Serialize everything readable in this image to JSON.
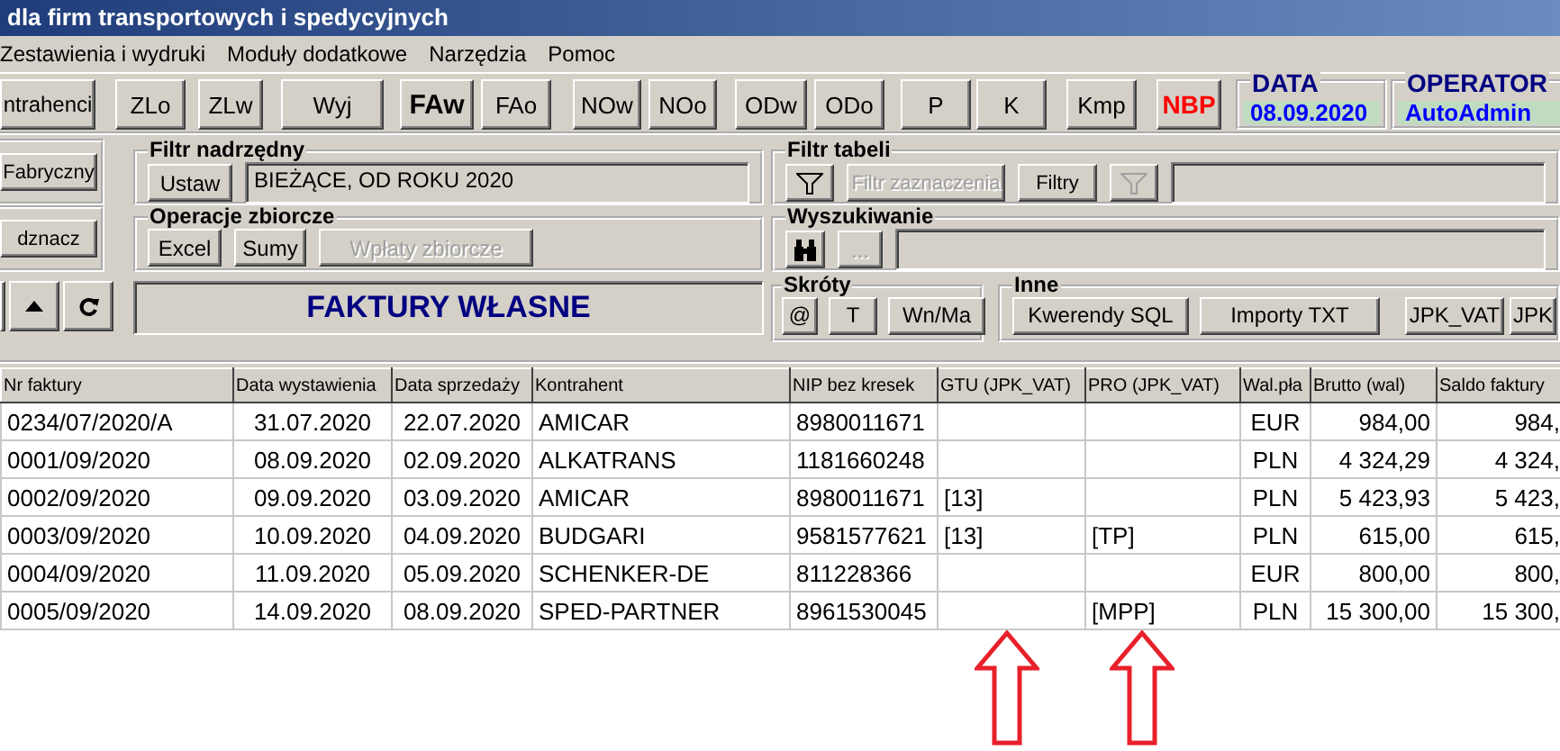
{
  "window": {
    "title": "dla firm transportowych i spedycyjnych"
  },
  "menu": [
    "Zestawienia i wydruki",
    "Moduły dodatkowe",
    "Narzędzia",
    "Pomoc"
  ],
  "toolbar": [
    {
      "label": "ntrahenci",
      "kind": "normal"
    },
    {
      "label": "ZLo",
      "kind": "normal"
    },
    {
      "label": "ZLw",
      "kind": "normal"
    },
    {
      "label": "Wyj",
      "kind": "normal"
    },
    {
      "label": "FAw",
      "kind": "bold"
    },
    {
      "label": "FAo",
      "kind": "normal"
    },
    {
      "label": "NOw",
      "kind": "normal"
    },
    {
      "label": "NOo",
      "kind": "normal"
    },
    {
      "label": "ODw",
      "kind": "normal"
    },
    {
      "label": "ODo",
      "kind": "normal"
    },
    {
      "label": "P",
      "kind": "normal"
    },
    {
      "label": "K",
      "kind": "normal"
    },
    {
      "label": "Kmp",
      "kind": "normal"
    },
    {
      "label": "NBP",
      "kind": "alert"
    }
  ],
  "info": [
    {
      "label": "DATA",
      "value": "08.09.2020"
    },
    {
      "label": "OPERATOR",
      "value": "AutoAdmin"
    }
  ],
  "side_buttons": [
    "Fabryczny",
    "dznacz"
  ],
  "filtr_nadrzedny": {
    "title": "Filtr nadrzędny",
    "button": "Ustaw",
    "value": "BIEŻĄCE, OD ROKU 2020"
  },
  "operacje_zbiorcze": {
    "title": "Operacje zbiorcze",
    "buttons": [
      {
        "label": "Excel",
        "disabled": false
      },
      {
        "label": "Sumy",
        "disabled": false
      },
      {
        "label": "Wpłaty zbiorcze",
        "disabled": true
      }
    ]
  },
  "banner": "FAKTURY WŁASNE",
  "filtr_tabeli": {
    "title": "Filtr tabeli",
    "tools": [
      {
        "kind": "funnel",
        "disabled": false
      },
      {
        "kind": "text",
        "label": "Filtr zaznaczenia",
        "disabled": true
      },
      {
        "kind": "text",
        "label": "Filtry",
        "disabled": false
      },
      {
        "kind": "funnel",
        "disabled": true
      }
    ]
  },
  "wyszukiwanie": {
    "title": "Wyszukiwanie",
    "tools": [
      {
        "kind": "binoculars",
        "disabled": false
      },
      {
        "kind": "text",
        "label": "...",
        "disabled": true
      }
    ]
  },
  "skroty": {
    "title": "Skróty",
    "buttons": [
      "@",
      "T",
      "Wn/Ma"
    ]
  },
  "inne": {
    "title": "Inne",
    "buttons": [
      "Kwerendy SQL",
      "Importy TXT",
      "JPK_VAT",
      "JPK"
    ]
  },
  "table": {
    "columns": [
      "Nr faktury",
      "Data wystawienia",
      "Data sprzedaży",
      "Kontrahent",
      "NIP bez kresek",
      "GTU (JPK_VAT)",
      "PRO (JPK_VAT)",
      "Wal.pła",
      "Brutto (wal)",
      "Saldo faktury"
    ],
    "rows": [
      [
        "0234/07/2020/A",
        "31.07.2020",
        "22.07.2020",
        "AMICAR",
        "8980011671",
        null,
        null,
        "EUR",
        "984,00",
        "984,"
      ],
      [
        "0001/09/2020",
        "08.09.2020",
        "02.09.2020",
        "ALKATRANS",
        "1181660248",
        null,
        null,
        "PLN",
        "4 324,29",
        "4 324,"
      ],
      [
        "0002/09/2020",
        "09.09.2020",
        "03.09.2020",
        "AMICAR",
        "8980011671",
        "[13]",
        null,
        "PLN",
        "5 423,93",
        "5 423,"
      ],
      [
        "0003/09/2020",
        "10.09.2020",
        "04.09.2020",
        "BUDGARI",
        "9581577621",
        "[13]",
        "[TP]",
        "PLN",
        "615,00",
        "615,"
      ],
      [
        "0004/09/2020",
        "11.09.2020",
        "05.09.2020",
        "SCHENKER-DE",
        "811228366",
        null,
        null,
        "EUR",
        "800,00",
        "800,"
      ],
      [
        "0005/09/2020",
        "14.09.2020",
        "08.09.2020",
        "SPED-PARTNER",
        "8961530045",
        null,
        "[MPP]",
        "PLN",
        "15 300,00",
        "15 300,"
      ]
    ]
  }
}
